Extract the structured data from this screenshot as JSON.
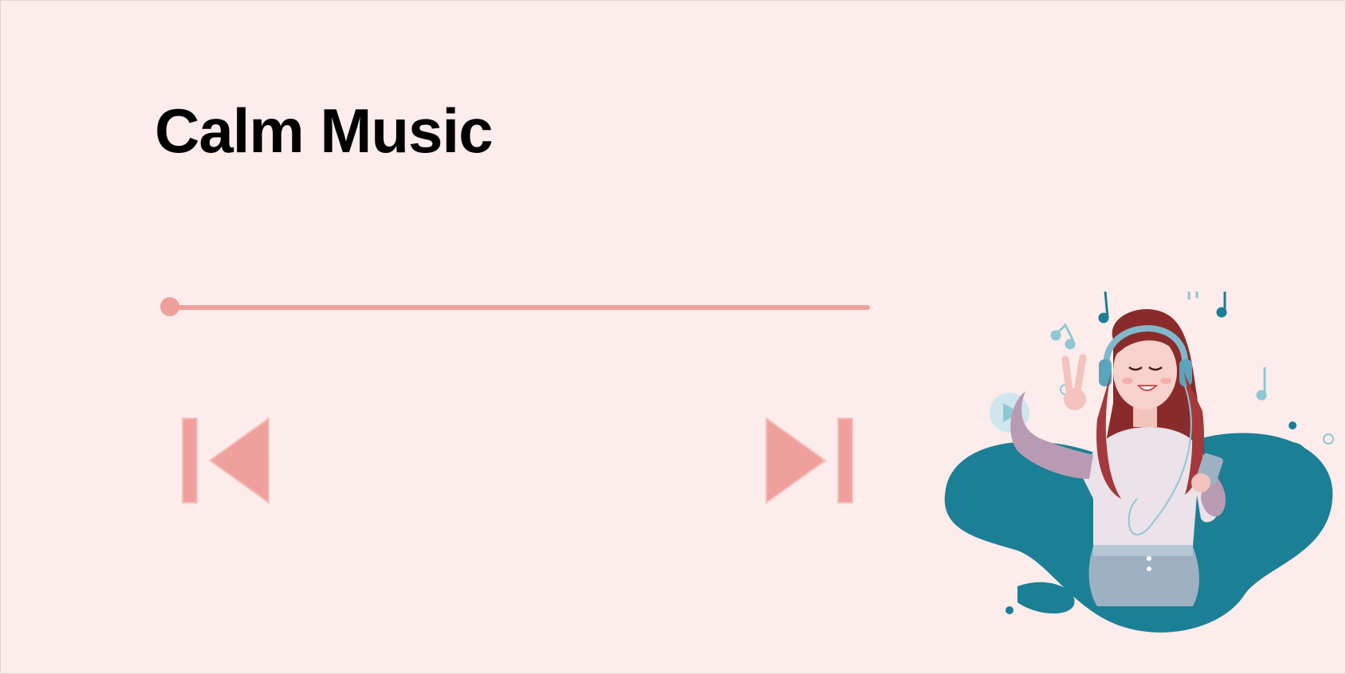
{
  "player": {
    "title": "Calm Music",
    "progress_fraction": 0.0
  },
  "controls": {
    "previous_icon": "skip-previous-icon",
    "next_icon": "skip-next-icon"
  },
  "illustration": {
    "icon": "girl-listening-music-illustration"
  },
  "colors": {
    "background": "#fcecec",
    "accent": "#f0a09c",
    "teal": "#1b7f95"
  }
}
